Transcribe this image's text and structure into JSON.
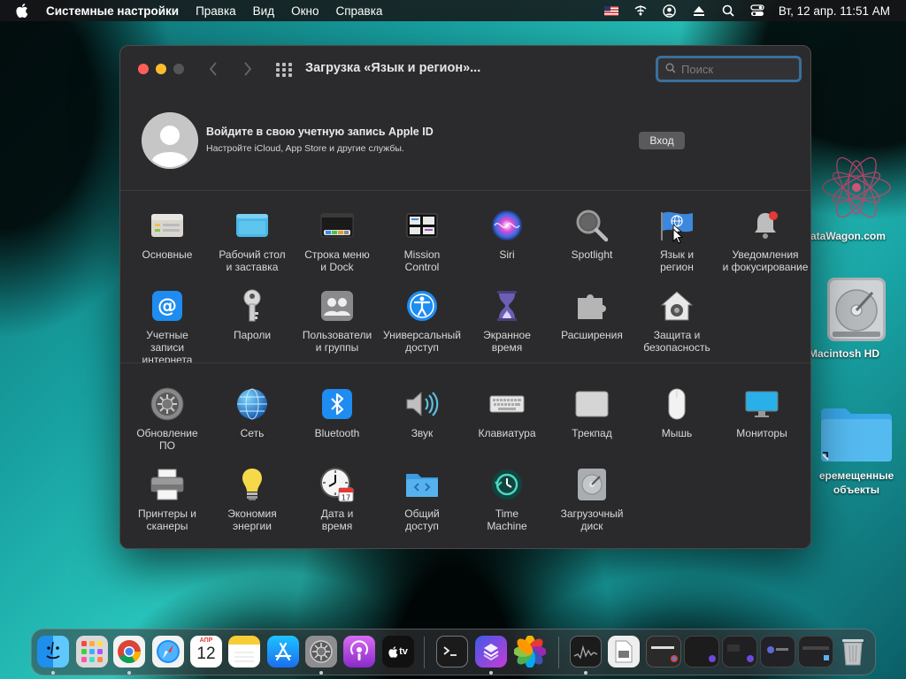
{
  "menubar": {
    "app_name": "Системные настройки",
    "items": [
      "Правка",
      "Вид",
      "Окно",
      "Справка"
    ],
    "clock": "Вт, 12 апр.  11:51 AM",
    "status_icons": [
      "us-flag-icon",
      "wifi-icon",
      "user-icon",
      "eject-icon",
      "search-icon",
      "control-center-icon"
    ]
  },
  "desktop": {
    "items": [
      {
        "label": "ataWagon.com"
      },
      {
        "label": "Macintosh HD"
      },
      {
        "label": "еремещенные\nобъекты"
      }
    ]
  },
  "window": {
    "title": "Загрузка «Язык и регион»...",
    "search_placeholder": "Поиск",
    "account": {
      "title": "Войдите в свою учетную запись Apple ID",
      "subtitle": "Настройте iCloud, App Store и другие службы.",
      "login_button": "Вход"
    },
    "panes_top": [
      {
        "label": "Основные",
        "icon": "general-icon"
      },
      {
        "label": "Рабочий стол\nи заставка",
        "icon": "desktop-icon"
      },
      {
        "label": "Строка меню\nи Dock",
        "icon": "dock-icon"
      },
      {
        "label": "Mission\nControl",
        "icon": "mission-control-icon"
      },
      {
        "label": "Siri",
        "icon": "siri-icon"
      },
      {
        "label": "Spotlight",
        "icon": "spotlight-icon"
      },
      {
        "label": "Язык и\nрегион",
        "icon": "language-region-icon"
      },
      {
        "label": "Уведомления\nи фокусирование",
        "icon": "notifications-icon"
      },
      {
        "label": "Учетные\nзаписи интернета",
        "icon": "internet-accounts-icon"
      },
      {
        "label": "Пароли",
        "icon": "passwords-icon"
      },
      {
        "label": "Пользователи\nи группы",
        "icon": "users-groups-icon"
      },
      {
        "label": "Универсальный\nдоступ",
        "icon": "accessibility-icon"
      },
      {
        "label": "Экранное\nвремя",
        "icon": "screen-time-icon"
      },
      {
        "label": "Расширения",
        "icon": "extensions-icon"
      },
      {
        "label": "Защита и\nбезопасность",
        "icon": "security-icon"
      }
    ],
    "panes_bottom": [
      {
        "label": "Обновление\nПО",
        "icon": "software-update-icon"
      },
      {
        "label": "Сеть",
        "icon": "network-icon"
      },
      {
        "label": "Bluetooth",
        "icon": "bluetooth-icon"
      },
      {
        "label": "Звук",
        "icon": "sound-icon"
      },
      {
        "label": "Клавиатура",
        "icon": "keyboard-icon"
      },
      {
        "label": "Трекпад",
        "icon": "trackpad-icon"
      },
      {
        "label": "Мышь",
        "icon": "mouse-icon"
      },
      {
        "label": "Мониторы",
        "icon": "displays-icon"
      },
      {
        "label": "Принтеры и\nсканеры",
        "icon": "printers-icon"
      },
      {
        "label": "Экономия\nэнергии",
        "icon": "energy-saver-icon"
      },
      {
        "label": "Дата и\nвремя",
        "icon": "date-time-icon"
      },
      {
        "label": "Общий\nдоступ",
        "icon": "sharing-icon"
      },
      {
        "label": "Time\nMachine",
        "icon": "time-machine-icon"
      },
      {
        "label": "Загрузочный\nдиск",
        "icon": "startup-disk-icon"
      }
    ]
  },
  "dock": {
    "calendar_month": "АПР",
    "calendar_day": "12",
    "tv_label": "tv",
    "apps": [
      "finder-icon",
      "launchpad-icon",
      "chrome-icon",
      "safari-icon",
      "calendar-icon",
      "notes-icon",
      "app-store-icon",
      "system-preferences-icon",
      "podcasts-icon",
      "apple-tv-icon",
      "terminal-icon",
      "shortcuts-icon",
      "photos-icon",
      "activity-monitor-icon",
      "preview-icon",
      "trash-icon"
    ]
  }
}
